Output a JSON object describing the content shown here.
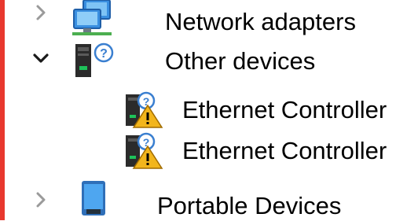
{
  "tree": {
    "items": [
      {
        "label": "Network adapters",
        "state": "collapsed",
        "icon": "network-adapter-icon"
      },
      {
        "label": "Other devices",
        "state": "expanded",
        "icon": "unknown-device-icon",
        "children": [
          {
            "label": "Ethernet Controller",
            "icon": "device-warning-icon"
          },
          {
            "label": "Ethernet Controller",
            "icon": "device-warning-icon"
          }
        ]
      },
      {
        "label": "Portable Devices",
        "state": "collapsed",
        "icon": "portable-device-icon"
      }
    ]
  },
  "colors": {
    "accent_edge": "#e8382e",
    "warning": "#f2b51c",
    "monitor_blue": "#3a8fe0",
    "chevron_collapsed": "#9a9a9a",
    "chevron_expanded": "#1a1a1a"
  }
}
